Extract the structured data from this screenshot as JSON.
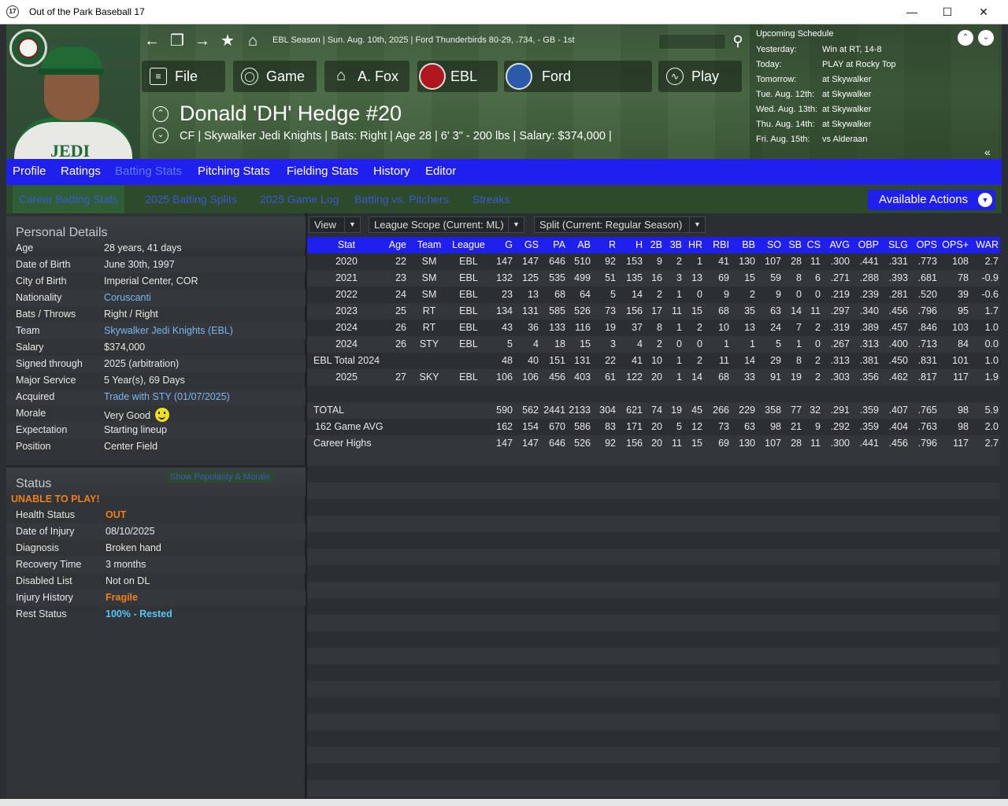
{
  "window": {
    "title": "Out of the Park Baseball 17",
    "app_badge": "17"
  },
  "header": {
    "breadcrumb": "EBL Season  |  Sun. Aug. 10th, 2025  |  Ford Thunderbirds  80-29, .734, - GB - 1st",
    "menu": [
      {
        "label": "File",
        "icon": "file-icon"
      },
      {
        "label": "Game",
        "icon": "globe-icon"
      },
      {
        "label": "A. Fox",
        "icon": "home-icon"
      },
      {
        "label": "EBL",
        "icon": "league-logo-icon"
      },
      {
        "label": "Ford",
        "icon": "team-logo-icon"
      },
      {
        "label": "Play",
        "icon": "baseball-icon"
      }
    ],
    "player_name": "Donald 'DH' Hedge  #20",
    "player_line": "CF | Skywalker Jedi Knights  |  Bats: Right  |  Age 28  |  6' 3\" - 200 lbs  |  Salary: $374,000  |",
    "jersey_text": "JEDI"
  },
  "schedule": {
    "title": "Upcoming Schedule",
    "rows": [
      {
        "day": "Yesterday:",
        "text": "Win at RT, 14-8"
      },
      {
        "day": "Today:",
        "text": "PLAY at Rocky Top"
      },
      {
        "day": "Tomorrow:",
        "text": "at Skywalker"
      },
      {
        "day": "Tue. Aug. 12th:",
        "text": "at Skywalker"
      },
      {
        "day": "Wed. Aug. 13th:",
        "text": "at Skywalker"
      },
      {
        "day": "Thu. Aug. 14th:",
        "text": "at Skywalker"
      },
      {
        "day": "Fri. Aug. 15th:",
        "text": "vs Alderaan"
      }
    ]
  },
  "tabs": [
    "Profile",
    "Ratings",
    "Batting Stats",
    "Pitching Stats",
    "Fielding Stats",
    "History",
    "Editor"
  ],
  "active_tab": "Batting Stats",
  "subtabs": [
    "Career Batting Stats",
    "2025 Batting Splits",
    "2025 Game Log",
    "Batting vs. Pitchers",
    "Streaks"
  ],
  "available_actions": "Available Actions",
  "personal_details": {
    "title": "Personal Details",
    "rows": [
      {
        "k": "Age",
        "v": "28 years, 41 days"
      },
      {
        "k": "Date of Birth",
        "v": "June 30th, 1997"
      },
      {
        "k": "City of Birth",
        "v": "Imperial Center, COR"
      },
      {
        "k": "Nationality",
        "v": "Coruscanti"
      },
      {
        "k": "Bats / Throws",
        "v": "Right / Right"
      },
      {
        "k": "Team",
        "v": "Skywalker Jedi Knights (EBL)"
      },
      {
        "k": "Salary",
        "v": "$374,000"
      },
      {
        "k": "Signed through",
        "v": "2025 (arbitration)"
      },
      {
        "k": "Major Service",
        "v": "5 Year(s), 69 Days"
      },
      {
        "k": "Acquired",
        "v": "Trade with STY (01/07/2025)"
      },
      {
        "k": "Morale",
        "v": "Very Good"
      },
      {
        "k": "Expectation",
        "v": "Starting lineup"
      },
      {
        "k": "Position",
        "v": "Center Field"
      }
    ]
  },
  "status": {
    "title": "Status",
    "show_link": "Show Popularity & Morale",
    "unable": "UNABLE TO PLAY!",
    "rows": [
      {
        "k": "Health Status",
        "v": "OUT"
      },
      {
        "k": "Date of Injury",
        "v": "08/10/2025"
      },
      {
        "k": "Diagnosis",
        "v": "Broken hand"
      },
      {
        "k": "Recovery Time",
        "v": "3 months"
      },
      {
        "k": "Disabled List",
        "v": "Not on DL"
      },
      {
        "k": "Injury History",
        "v": "Fragile"
      },
      {
        "k": "Rest Status",
        "v": "100% - Rested"
      }
    ]
  },
  "filters": {
    "view": "View",
    "scope": "League Scope  (Current: ML)",
    "split": "Split  (Current: Regular Season)"
  },
  "stats": {
    "columns": [
      "Stat",
      "Age",
      "Team",
      "League",
      "G",
      "GS",
      "PA",
      "AB",
      "R",
      "H",
      "2B",
      "3B",
      "HR",
      "RBI",
      "BB",
      "SO",
      "SB",
      "CS",
      "AVG",
      "OBP",
      "SLG",
      "OPS",
      "OPS+",
      "WAR"
    ],
    "rows": [
      [
        "2020",
        "22",
        "SM",
        "EBL",
        "147",
        "147",
        "646",
        "510",
        "92",
        "153",
        "9",
        "2",
        "1",
        "41",
        "130",
        "107",
        "28",
        "11",
        ".300",
        ".441",
        ".331",
        ".773",
        "108",
        "2.7"
      ],
      [
        "2021",
        "23",
        "SM",
        "EBL",
        "132",
        "125",
        "535",
        "499",
        "51",
        "135",
        "16",
        "3",
        "13",
        "69",
        "15",
        "59",
        "8",
        "6",
        ".271",
        ".288",
        ".393",
        ".681",
        "78",
        "-0.9"
      ],
      [
        "2022",
        "24",
        "SM",
        "EBL",
        "23",
        "13",
        "68",
        "64",
        "5",
        "14",
        "2",
        "1",
        "0",
        "9",
        "2",
        "9",
        "0",
        "0",
        ".219",
        ".239",
        ".281",
        ".520",
        "39",
        "-0.6"
      ],
      [
        "2023",
        "25",
        "RT",
        "EBL",
        "134",
        "131",
        "585",
        "526",
        "73",
        "156",
        "17",
        "11",
        "15",
        "68",
        "35",
        "63",
        "14",
        "11",
        ".297",
        ".340",
        ".456",
        ".796",
        "95",
        "1.7"
      ],
      [
        "2024",
        "26",
        "RT",
        "EBL",
        "43",
        "36",
        "133",
        "116",
        "19",
        "37",
        "8",
        "1",
        "2",
        "10",
        "13",
        "24",
        "7",
        "2",
        ".319",
        ".389",
        ".457",
        ".846",
        "103",
        "1.0"
      ],
      [
        "2024",
        "26",
        "STY",
        "EBL",
        "5",
        "4",
        "18",
        "15",
        "3",
        "4",
        "2",
        "0",
        "0",
        "1",
        "1",
        "5",
        "1",
        "0",
        ".267",
        ".313",
        ".400",
        ".713",
        "84",
        "0.0"
      ],
      [
        "EBL Total 2024",
        "",
        "",
        "",
        "48",
        "40",
        "151",
        "131",
        "22",
        "41",
        "10",
        "1",
        "2",
        "11",
        "14",
        "29",
        "8",
        "2",
        ".313",
        ".381",
        ".450",
        ".831",
        "101",
        "1.0"
      ],
      [
        "2025",
        "27",
        "SKY",
        "EBL",
        "106",
        "106",
        "456",
        "403",
        "61",
        "122",
        "20",
        "1",
        "14",
        "68",
        "33",
        "91",
        "19",
        "2",
        ".303",
        ".356",
        ".462",
        ".817",
        "117",
        "1.9"
      ],
      [
        "",
        "",
        "",
        "",
        "",
        "",
        "",
        "",
        "",
        "",
        "",
        "",
        "",
        "",
        "",
        "",
        "",
        "",
        "",
        "",
        "",
        "",
        "",
        ""
      ],
      [
        "TOTAL",
        "",
        "",
        "",
        "590",
        "562",
        "2441",
        "2133",
        "304",
        "621",
        "74",
        "19",
        "45",
        "266",
        "229",
        "358",
        "77",
        "32",
        ".291",
        ".359",
        ".407",
        ".765",
        "98",
        "5.9"
      ],
      [
        "162 Game AVG",
        "",
        "",
        "",
        "162",
        "154",
        "670",
        "586",
        "83",
        "171",
        "20",
        "5",
        "12",
        "73",
        "63",
        "98",
        "21",
        "9",
        ".292",
        ".359",
        ".404",
        ".763",
        "98",
        "2.0"
      ],
      [
        "Career Highs",
        "",
        "",
        "",
        "147",
        "147",
        "646",
        "526",
        "92",
        "156",
        "20",
        "11",
        "15",
        "69",
        "130",
        "107",
        "28",
        "11",
        ".300",
        ".441",
        ".456",
        ".796",
        "117",
        "2.7"
      ]
    ]
  },
  "colors": {
    "tab_bar": "#2020ee",
    "header_green": "#496a44",
    "link": "#7ab6f0",
    "warning": "#f07f1c",
    "rest": "#55c6f6"
  }
}
